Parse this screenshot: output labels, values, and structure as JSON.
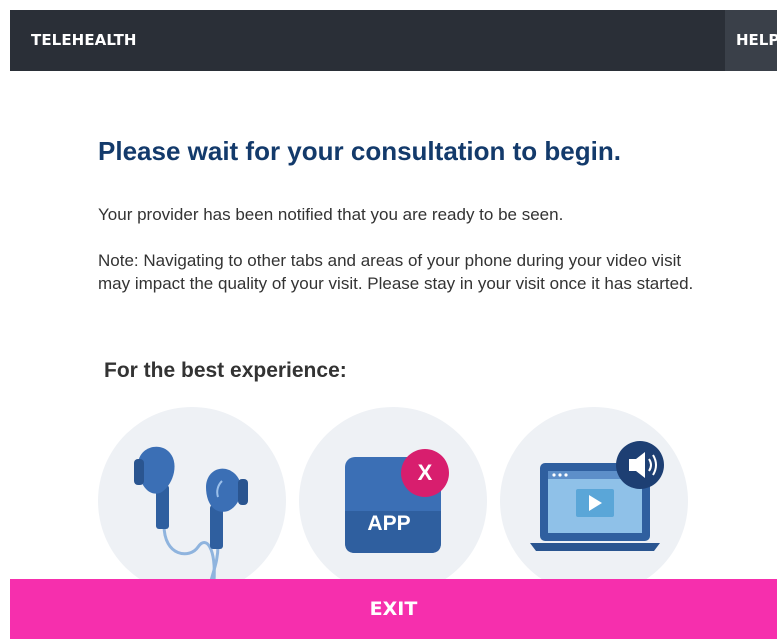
{
  "header": {
    "title": "TELEHEALTH",
    "help_label": "HELP"
  },
  "main": {
    "heading": "Please wait for your consultation to begin.",
    "notified_text": "Your provider has been notified that you are ready to be seen.",
    "note_text": "Note: Navigating to other tabs and areas of your phone during your video visit may impact the quality of your visit. Please stay in your visit once it has started.",
    "best_experience_title": "For the best experience:",
    "tips": [
      {
        "icon": "earphones-icon"
      },
      {
        "icon": "app-closed-icon",
        "app_label": "APP",
        "badge_label": "X"
      },
      {
        "icon": "laptop-sound-icon"
      }
    ]
  },
  "footer": {
    "exit_label": "EXIT"
  },
  "colors": {
    "header_bg": "#2a2f37",
    "heading": "#133a6b",
    "exit_bg": "#f62fad",
    "badge": "#d81e6e",
    "icon_blue": "#3b6fb5"
  }
}
